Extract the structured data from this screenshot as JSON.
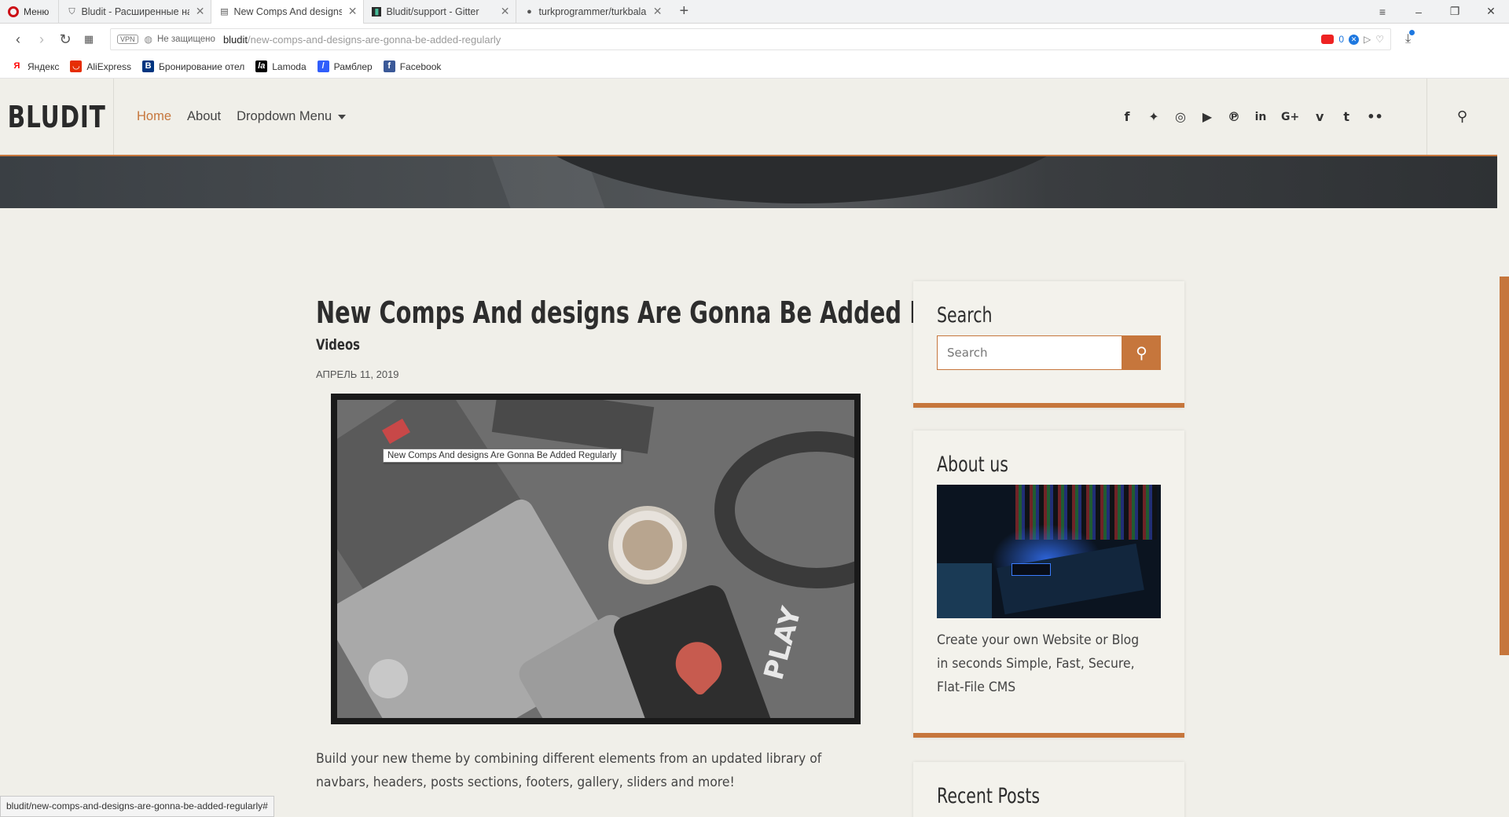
{
  "browser": {
    "menu_label": "Меню",
    "tabs": [
      {
        "title": "Bludit - Расширенные на",
        "active": false
      },
      {
        "title": "New Comps And designs A",
        "active": true
      },
      {
        "title": "Bludit/support - Gitter",
        "active": false
      },
      {
        "title": "turkprogrammer/turkbala",
        "active": false
      }
    ],
    "vpn_label": "VPN",
    "security_label": "Не защищено",
    "url_host": "bludit",
    "url_path": "/new-comps-and-designs-are-gonna-be-added-regularly",
    "badge_count": "0",
    "bookmarks": [
      {
        "label": "Яндекс",
        "icon": "yandex-icon",
        "color": "#ff0000"
      },
      {
        "label": "AliExpress",
        "icon": "aliexpress-icon",
        "color": "#e62e04"
      },
      {
        "label": "Бронирование отел",
        "icon": "booking-icon",
        "color": "#003580"
      },
      {
        "label": "Lamoda",
        "icon": "lamoda-icon",
        "color": "#000000"
      },
      {
        "label": "Рамблер",
        "icon": "rambler-icon",
        "color": "#315efb"
      },
      {
        "label": "Facebook",
        "icon": "facebook-icon",
        "color": "#3b5998"
      }
    ],
    "status_url": "bludit/new-comps-and-designs-are-gonna-be-added-regularly#"
  },
  "site": {
    "logo": "BLUDIT",
    "nav": [
      {
        "label": "Home",
        "active": true
      },
      {
        "label": "About",
        "active": false
      },
      {
        "label": "Dropdown Menu",
        "active": false
      }
    ],
    "social_icons": [
      "facebook-icon",
      "twitter-icon",
      "instagram-icon",
      "youtube-icon",
      "pinterest-icon",
      "linkedin-icon",
      "google-plus-icon",
      "vimeo-icon",
      "tumblr-icon",
      "flickr-icon"
    ],
    "accent_color": "#c6763c"
  },
  "post": {
    "title": "New Comps And designs Are Gonna Be Added Regularly",
    "category": "Videos",
    "date": "АПРЕЛЬ 11, 2019",
    "image_tooltip": "New Comps And designs Are Gonna Be Added Regularly",
    "image_text": "PLAY",
    "body": "Build your new theme by combining different elements from an updated library of navbars, headers, posts sections, footers, gallery, sliders and more!"
  },
  "sidebar": {
    "search_title": "Search",
    "search_placeholder": "Search",
    "about_title": "About us",
    "about_text": "Create your own Website or Blog in seconds Simple, Fast, Secure, Flat-File CMS",
    "recent_title": "Recent Posts"
  }
}
